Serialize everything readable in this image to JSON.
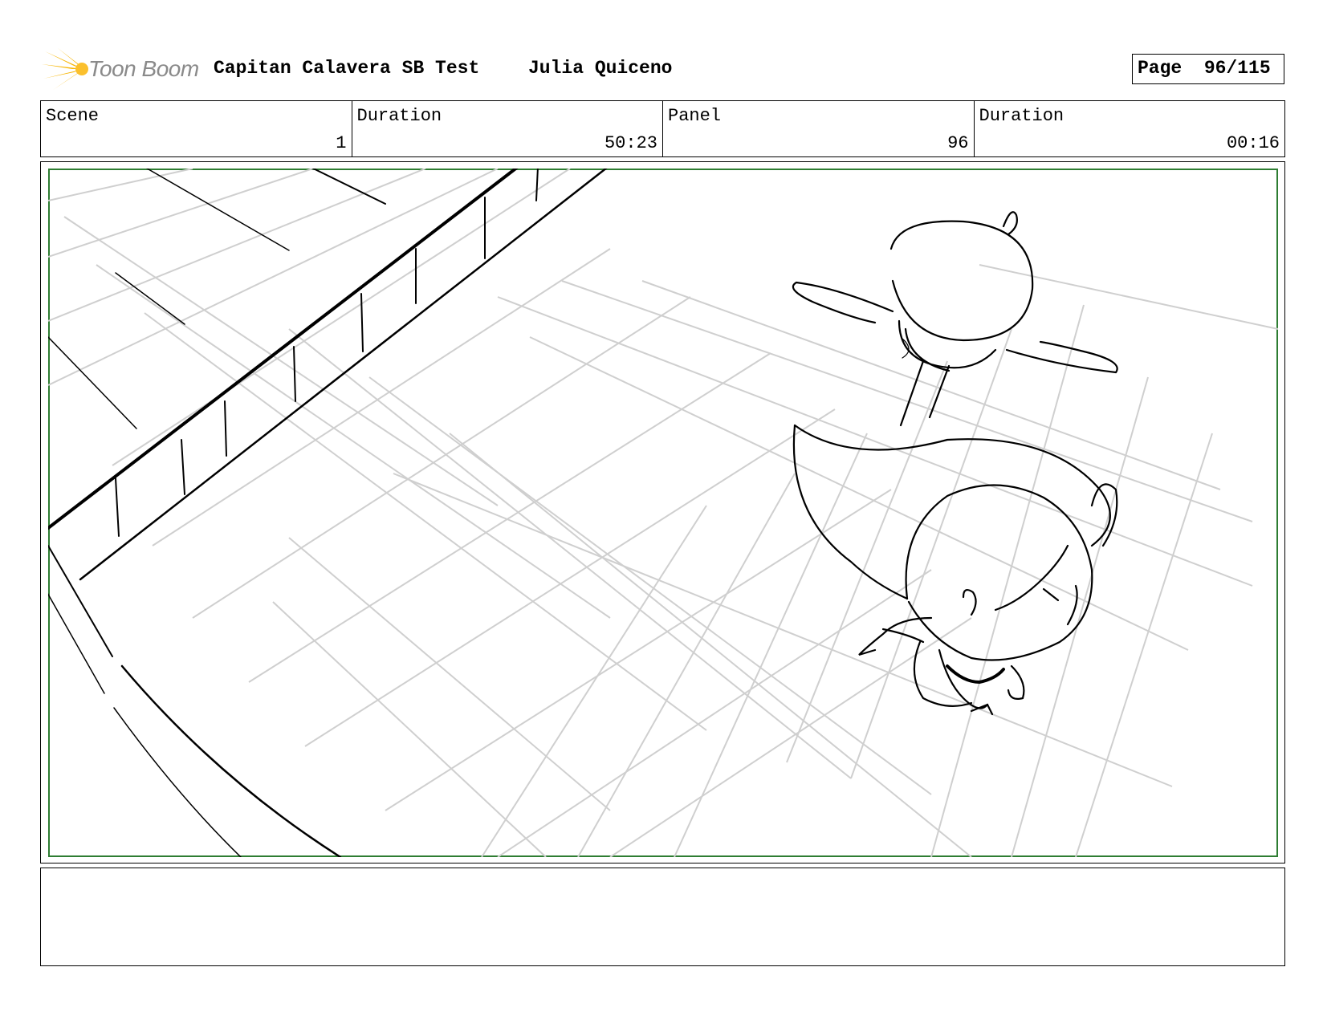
{
  "header": {
    "logo_text": "Toon Boom",
    "project_title": "Capitan Calavera SB Test",
    "artist": "Julia Quiceno",
    "page_label": "Page",
    "page_value": "96/115"
  },
  "info": [
    {
      "label": "Scene",
      "value": "1"
    },
    {
      "label": "Duration",
      "value": "50:23"
    },
    {
      "label": "Panel",
      "value": "96"
    },
    {
      "label": "Duration",
      "value": "00:16"
    }
  ],
  "colors": {
    "logo_yellow": "#f7b500",
    "safe_frame_green": "#2e7d32",
    "grid_gray": "#c8c8c8"
  },
  "notes": ""
}
